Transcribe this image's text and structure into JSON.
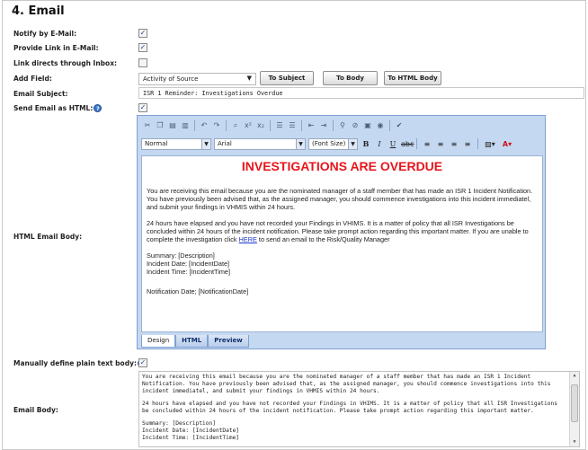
{
  "section_title": "4. Email",
  "labels": {
    "notify": "Notify by E-Mail:",
    "provide_link": "Provide Link in E-Mail:",
    "link_inbox": "Link directs through Inbox:",
    "add_field": "Add Field:",
    "email_subject": "Email Subject:",
    "send_html": "Send Email as HTML:",
    "html_body": "HTML Email Body:",
    "manual_plain": "Manually define plain text body:",
    "email_body": "Email Body:"
  },
  "checkboxes": {
    "notify": true,
    "provide_link": true,
    "link_inbox": false,
    "send_html": true,
    "manual_plain": true
  },
  "add_field": {
    "selected": "Activity of Source",
    "buttons": [
      "To Subject",
      "To Body",
      "To HTML Body"
    ]
  },
  "email_subject_value": "ISR 1 Reminder: Investigations Overdue",
  "editor": {
    "format_select": "Normal",
    "font_select": "Arial",
    "size_select": "(Font Size)",
    "tabs": [
      "Design",
      "HTML",
      "Preview"
    ],
    "active_tab": "Design",
    "headline": "INVESTIGATIONS ARE OVERDUE",
    "para1": "You are receiving this email because you are the nominated manager of a staff member that has made an ISR 1 Incident Notification. You have previously been advised that, as the assigned manager, you should commence investigations into this incident immediatel, and submit your findings in VHMIS within 24 hours.",
    "para2_pre": "24 hours have elapsed and you have not recorded your Findings in VHIMS. It is a matter of policy that all ISR Investigations be concluded within 24 hours of the incident notification. Please take prompt action regarding this important matter. If you are unable to complete the investigation click ",
    "para2_link": "HERE",
    "para2_post": " to send an email to the Risk/Quality Manager",
    "summary": "Summary: [Description]",
    "incident_date": "Incident Date: [IncidentDate]",
    "incident_time": "Incident Time: [IncidentTime]",
    "notification_date": "Notification Date; [NotificationDate]"
  },
  "plain_body": {
    "para1": "You are receiving this email because you are the nominated manager of a staff member that has made an ISR 1 Incident Notification. You have previously been advised that, as the assigned manager, you should commence investigations into this incident immediatel, and submit your findings in VHMIS within 24 hours.",
    "para2": "24 hours have elapsed and you have not recorded your Findings in VHIMS. It is a matter of policy that all ISR Investigations be concluded within 24 hours of the incident notification. Please take prompt action regarding this important matter.",
    "summary": "Summary: [Description]",
    "incident_date": "Incident Date: [IncidentDate]",
    "incident_time": "Incident Time: [IncidentTime]"
  }
}
